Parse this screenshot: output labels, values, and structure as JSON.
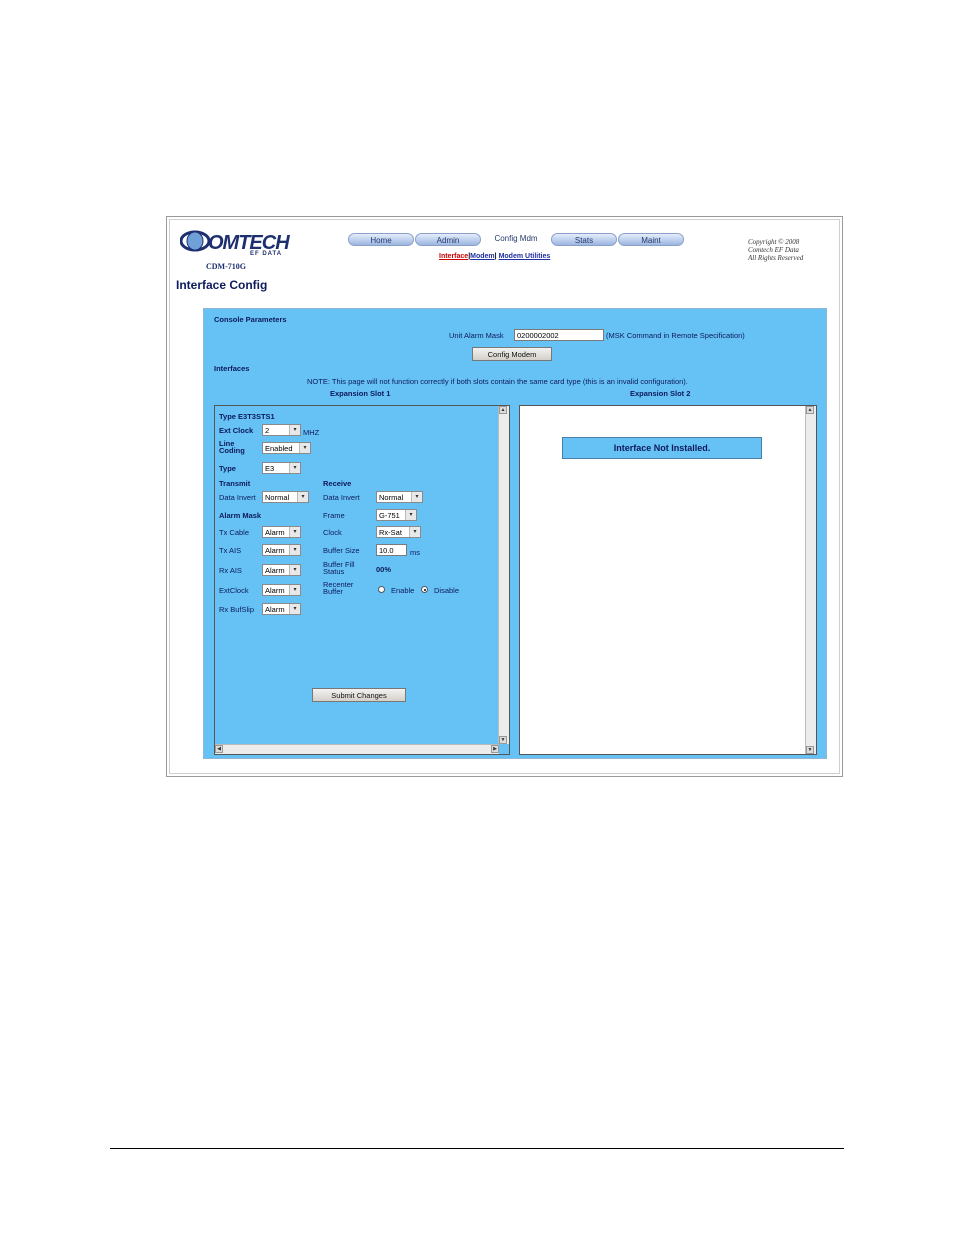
{
  "header": {
    "logo_word": "OMTECH",
    "logo_sub": "EF DATA",
    "model": "CDM-710G",
    "nav_tabs": [
      "Home",
      "Admin",
      "Config Mdm",
      "Stats",
      "Maint"
    ],
    "subnav": [
      "Interface",
      "Modem",
      "Modem Utilities"
    ],
    "copyright_line1": "Copyright © 2008",
    "copyright_line2": "Comtech EF Data",
    "copyright_line3": "All Rights Reserved"
  },
  "page_title": "Interface Config",
  "console": {
    "section_label": "Console Parameters",
    "alarm_mask_label": "Unit Alarm Mask",
    "alarm_mask_value": "0200002002",
    "alarm_mask_note": "(MSK Command in Remote Specification)",
    "config_button": "Config Modem"
  },
  "interfaces": {
    "section_label": "Interfaces",
    "note": "NOTE: This page will not function correctly if both slots contain the same card type (this is an invalid configuration).",
    "slot1_heading": "Expansion Slot 1",
    "slot2_heading": "Expansion Slot 2"
  },
  "slot1": {
    "type_label": "Type E3T3STS1",
    "ext_clock_label": "Ext Clock",
    "ext_clock_value": "2",
    "ext_clock_unit": "MHZ",
    "line_coding_label1": "Line",
    "line_coding_label2": "Coding",
    "line_coding_value": "Enabled",
    "type_field_label": "Type",
    "type_field_value": "E3",
    "transmit_label": "Transmit",
    "receive_label": "Receive",
    "tx_data_invert_label": "Data Invert",
    "tx_data_invert_value": "Normal",
    "rx_data_invert_label": "Data Invert",
    "rx_data_invert_value": "Normal",
    "alarm_mask_label": "Alarm Mask",
    "frame_label": "Frame",
    "frame_value": "G-751",
    "tx_cable_label": "Tx Cable",
    "tx_cable_value": "Alarm",
    "clock_label": "Clock",
    "clock_value": "Rx-Sat",
    "tx_ais_label": "Tx AIS",
    "tx_ais_value": "Alarm",
    "buffer_size_label": "Buffer Size",
    "buffer_size_value": "10.0",
    "buffer_size_unit": "ms",
    "rx_ais_label": "Rx AIS",
    "rx_ais_value": "Alarm",
    "buffer_fill_label1": "Buffer Fill",
    "buffer_fill_label2": "Status",
    "buffer_fill_value": "00%",
    "extclock_label": "ExtClock",
    "extclock_value": "Alarm",
    "recenter_label1": "Recenter",
    "recenter_label2": "Buffer",
    "recenter_enable": "Enable",
    "recenter_disable": "Disable",
    "recenter_selected": "Disable",
    "rx_bufslip_label": "Rx BufSlip",
    "rx_bufslip_value": "Alarm",
    "submit_button": "Submit Changes"
  },
  "slot2": {
    "message": "Interface Not Installed."
  }
}
